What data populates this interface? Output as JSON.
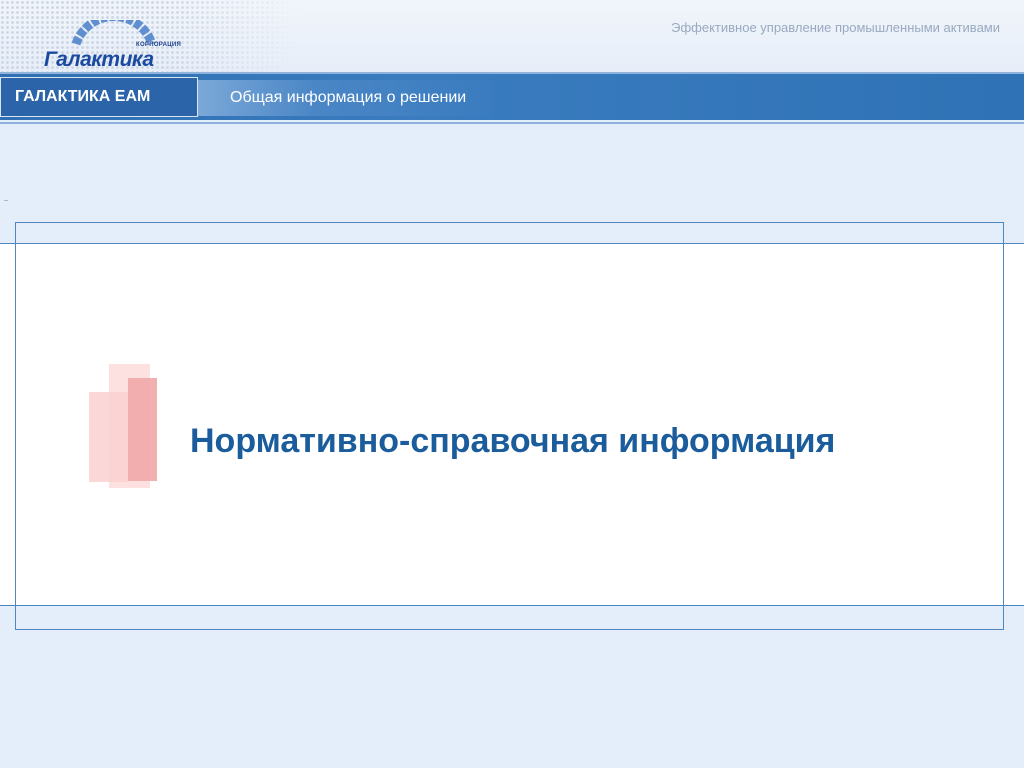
{
  "header": {
    "logo_small": "КОРПОРАЦИЯ",
    "logo_text": "Галактика",
    "tagline": "Эффективное управление промышленными активами"
  },
  "nav": {
    "brand": "ГАЛАКТИКА ЕАМ",
    "section": "Общая информация о решении"
  },
  "slide": {
    "title": "Нормативно-справочная информация"
  },
  "colors": {
    "nav_blue": "#3a7cbf",
    "title_blue": "#1b5c9c",
    "accent_pink": "#f2a5a5"
  }
}
